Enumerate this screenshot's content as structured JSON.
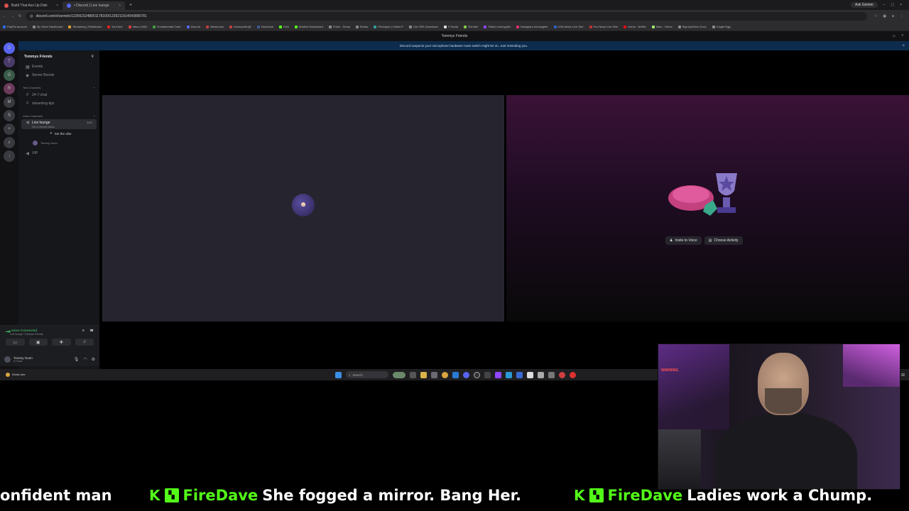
{
  "browser": {
    "tabs": [
      {
        "label": "Build That Ass Up Disk",
        "color": "#e05050"
      },
      {
        "label": "• Discord | Live lounge",
        "color": "#5865f2"
      }
    ],
    "new_tab": "+",
    "ask_label": "Ask Gemini",
    "url": "discord.com/channels/1226615248001178109/1226211914043895781",
    "bookmarks": [
      {
        "label": "PayPal account",
        "color": "#2a6df4"
      },
      {
        "label": "My Store Dashboard",
        "color": "#888888"
      },
      {
        "label": "Streaming | Rubiktoast",
        "color": "#e0a030"
      },
      {
        "label": "YouTube",
        "color": "#e02020"
      },
      {
        "label": "Inbox (108)",
        "color": "#d04040"
      },
      {
        "label": "Fundamental Cash",
        "color": "#40a040"
      },
      {
        "label": "Discord",
        "color": "#5865f2"
      },
      {
        "label": "Newsroom",
        "color": "#c04040"
      },
      {
        "label": "tommyvelio@",
        "color": "#c04040"
      },
      {
        "label": "Facebook",
        "color": "#3b5998"
      },
      {
        "label": "Kick",
        "color": "#53fc18"
      },
      {
        "label": "KickBot Dashboard",
        "color": "#53fc18"
      },
      {
        "label": "Pulse - Setup",
        "color": "#888888"
      },
      {
        "label": "Extras",
        "color": "#888888"
      },
      {
        "label": "Photopea | Online P",
        "color": "#30a0a0"
      },
      {
        "label": "Get VBS Download",
        "color": "#888888"
      },
      {
        "label": "X Social",
        "color": "#dddddd"
      },
      {
        "label": "Rumble",
        "color": "#85c742"
      },
      {
        "label": "Twitch tommyglee",
        "color": "#9146ff"
      },
      {
        "label": "Instagram tommyglee",
        "color": "#e1306c"
      },
      {
        "label": "USA News Live Stre",
        "color": "#3060c0"
      },
      {
        "label": "Fox News Live Stre",
        "color": "#c03030"
      },
      {
        "label": "Home - Netflix",
        "color": "#e50914"
      },
      {
        "label": "Wise - Home",
        "color": "#9fe870"
      },
      {
        "label": "SignUp/Drive Docs",
        "color": "#888888"
      },
      {
        "label": "Jungle Egg",
        "color": "#888888"
      }
    ]
  },
  "discord": {
    "title": "Tommys Friends",
    "notice": "Discord suspects your microphone hardware mute switch might be on. Just reminding you.",
    "servers": [
      "D",
      "T",
      "G",
      "R",
      "M",
      "S",
      "+",
      "⌕",
      "↓"
    ],
    "server_name": "Tommys Friends",
    "top_items": [
      {
        "glyph": "▦",
        "label": "Events"
      },
      {
        "glyph": "◆",
        "label": "Server Boosts"
      }
    ],
    "text_category": "Text Channels",
    "text_channels": [
      "24-7-chat",
      "streaming-tips"
    ],
    "voice_category": "Voice Channels",
    "voice_channel": {
      "label": "Live lounge",
      "sub": "Set a channel status",
      "count": "1/12"
    },
    "vibe_label": "Set the vibe",
    "voice_user": "Tommy Gunn",
    "vip_channel": "VIP",
    "voice_connected": "Voice Connected",
    "voice_sub": "Live lounge / Tommys Friends",
    "user_name": "Tommy Gunn",
    "user_status": "In Voice",
    "invite_label": "Invite to Voice",
    "activity_label": "Choose Activity"
  },
  "taskbar": {
    "weather": "Mostly clear",
    "search": "Search"
  },
  "webcam": {
    "warning": "WARNING"
  },
  "ticker": {
    "fragment": "onfident man",
    "messages": [
      {
        "user": "FireDave",
        "text": "She fogged a mirror. Bang Her."
      },
      {
        "user": "FireDave",
        "text": "Ladies work a Chump."
      }
    ]
  },
  "colors": {
    "kick_green": "#53fc18",
    "discord_blurple": "#5865f2",
    "voice_green": "#3ba55d"
  }
}
